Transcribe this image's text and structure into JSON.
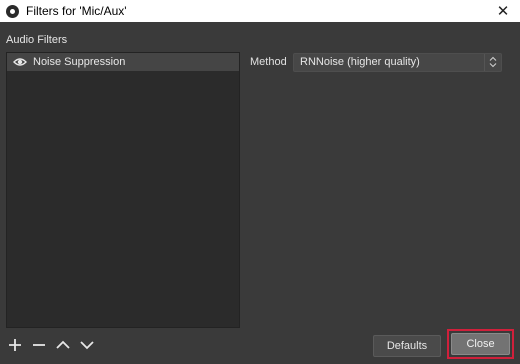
{
  "window": {
    "title": "Filters for 'Mic/Aux'",
    "close_glyph": "✕"
  },
  "audio_filters": {
    "label": "Audio Filters",
    "items": [
      {
        "name": "Noise Suppression",
        "visible": true,
        "icon": "eye-icon"
      }
    ]
  },
  "toolbar": {
    "buttons": [
      {
        "name": "add-filter-button",
        "icon": "plus-icon"
      },
      {
        "name": "remove-filter-button",
        "icon": "minus-icon"
      },
      {
        "name": "move-up-button",
        "icon": "chevron-up-icon"
      },
      {
        "name": "move-down-button",
        "icon": "chevron-down-icon"
      }
    ]
  },
  "properties": {
    "method_label": "Method",
    "method_value": "RNNoise (higher quality)"
  },
  "buttons": {
    "defaults_label": "Defaults",
    "close_label": "Close"
  },
  "colors": {
    "background": "#3a3a3a",
    "list_background": "#2b2b2b",
    "selected_item": "#454545",
    "highlight_border": "#d0203b"
  }
}
